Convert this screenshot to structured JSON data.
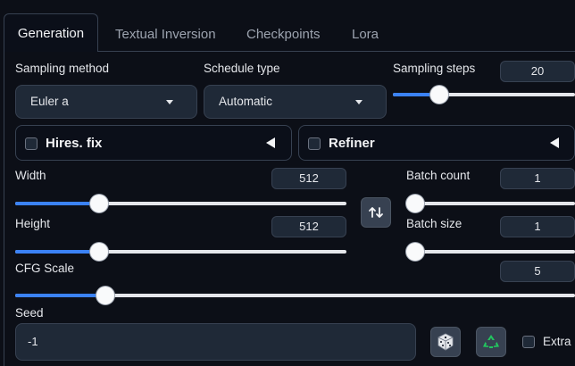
{
  "tabs": [
    {
      "label": "Generation",
      "active": true
    },
    {
      "label": "Textual Inversion",
      "active": false
    },
    {
      "label": "Checkpoints",
      "active": false
    },
    {
      "label": "Lora",
      "active": false
    }
  ],
  "sampling_method": {
    "label": "Sampling method",
    "value": "Euler a"
  },
  "schedule_type": {
    "label": "Schedule type",
    "value": "Automatic"
  },
  "sampling_steps": {
    "label": "Sampling steps",
    "value": "20",
    "fraction": 0.23
  },
  "hires_fix": {
    "label": "Hires. fix",
    "checked": false
  },
  "refiner": {
    "label": "Refiner",
    "checked": false
  },
  "width": {
    "label": "Width",
    "value": "512",
    "fraction": 0.24
  },
  "height": {
    "label": "Height",
    "value": "512",
    "fraction": 0.24
  },
  "batch_count": {
    "label": "Batch count",
    "value": "1",
    "fraction": 0.0
  },
  "batch_size": {
    "label": "Batch size",
    "value": "1",
    "fraction": 0.0
  },
  "cfg_scale": {
    "label": "CFG Scale",
    "value": "5",
    "fraction": 0.15
  },
  "seed": {
    "label": "Seed",
    "value": "-1"
  },
  "extra": {
    "label": "Extra",
    "checked": false
  },
  "colors": {
    "accent": "#3b82f6",
    "background": "#0c0f17",
    "input_bg": "#1f2937",
    "border": "#374151",
    "recycle_green": "#22c55e"
  },
  "icons": {
    "swap": "swap-arrows-icon",
    "dice": "dice-icon",
    "recycle": "recycle-icon"
  }
}
